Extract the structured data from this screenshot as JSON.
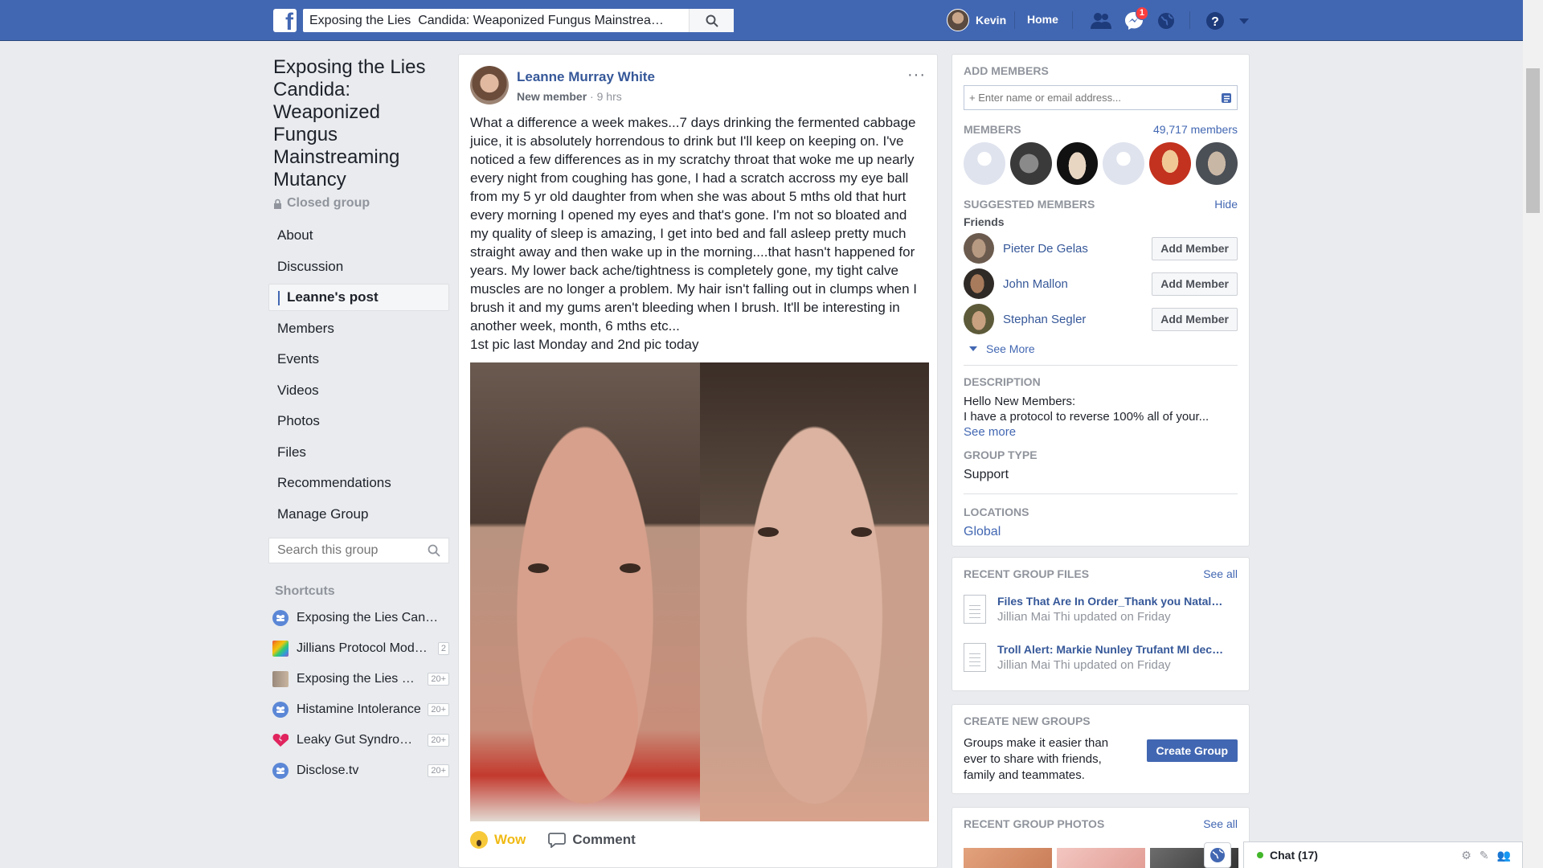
{
  "topbar": {
    "logo": "f",
    "search_value": "Exposing the Lies  Candida: Weaponized Fungus Mainstrea…",
    "user_name": "Kevin",
    "home_label": "Home",
    "messages_badge": "1"
  },
  "left": {
    "group_title": "Exposing the Lies Candida: Weaponized Fungus Mainstreaming Mutancy",
    "privacy": "Closed group",
    "nav": [
      "About",
      "Discussion",
      "Leanne's post",
      "Members",
      "Events",
      "Videos",
      "Photos",
      "Files",
      "Recommendations",
      "Manage Group"
    ],
    "search_placeholder": "Search this group",
    "shortcuts_title": "Shortcuts",
    "shortcuts": [
      {
        "label": "Exposing the Lies Cand…",
        "count": "",
        "icon": "group-icon"
      },
      {
        "label": "Jillians Protocol Mod…",
        "count": "2",
        "icon": "rainbow-icon"
      },
      {
        "label": "Exposing the Lies …",
        "count": "20+",
        "icon": "photo-icon"
      },
      {
        "label": "Histamine Intolerance",
        "count": "20+",
        "icon": "group-icon"
      },
      {
        "label": "Leaky Gut Syndro…",
        "count": "20+",
        "icon": "broken-heart-icon"
      },
      {
        "label": "Disclose.tv",
        "count": "20+",
        "icon": "group-icon"
      }
    ]
  },
  "post": {
    "author": "Leanne Murray White",
    "role": "New member",
    "time": "9 hrs",
    "text": "What a difference a week makes...7 days drinking the fermented cabbage juice, it is absolutely horrendous to drink but I'll keep on keeping on. I've noticed a few differences as in my scratchy throat that woke me up nearly every night from coughing has gone, I had a scratch accross my eye ball from my 5 yr old daughter from when she was about 5 mths old that hurt every morning I opened my eyes and that's gone. I'm not so bloated and my quality of sleep is amazing, I get into bed and fall asleep pretty much straight away and then wake up in the morning....that hasn't happened for years. My lower back ache/tightness is completely gone, my tight calve muscles are no longer a problem. My hair isn't falling out in clumps when I brush it and my gums aren't bleeding when I brush. It'll be interesting in another week, month, 6 mths etc...",
    "text2": "1st pic last Monday and 2nd pic today",
    "wow_label": "Wow",
    "comment_label": "Comment"
  },
  "right": {
    "add_members_title": "ADD MEMBERS",
    "add_placeholder": "+ Enter name or email address...",
    "members_title": "MEMBERS",
    "members_count": "49,717 members",
    "suggested_title": "SUGGESTED MEMBERS",
    "hide_label": "Hide",
    "friends_label": "Friends",
    "suggested": [
      {
        "name": "Pieter De Gelas",
        "button": "Add Member"
      },
      {
        "name": "John Mallon",
        "button": "Add Member"
      },
      {
        "name": "Stephan Segler",
        "button": "Add Member"
      }
    ],
    "see_more": "See More",
    "description_title": "DESCRIPTION",
    "description_line1": "Hello New Members:",
    "description_line2": "I have a protocol to reverse 100% all of your...",
    "description_see_more": "See more",
    "group_type_title": "GROUP TYPE",
    "group_type": "Support",
    "locations_title": "LOCATIONS",
    "location": "Global",
    "files_title": "RECENT GROUP FILES",
    "files_see_all": "See all",
    "files": [
      {
        "title": "Files That Are In Order_Thank you Natal…",
        "meta": "Jillian Mai Thi updated on Friday"
      },
      {
        "title": "Troll Alert: Markie Nunley Trufant MI dec…",
        "meta": "Jillian Mai Thi updated on Friday"
      }
    ],
    "create_title": "CREATE NEW GROUPS",
    "create_text": "Groups make it easier than ever to share with friends, family and teammates.",
    "create_button": "Create Group",
    "photos_title": "RECENT GROUP PHOTOS",
    "photos_see_all": "See all"
  },
  "chat": {
    "label": "Chat (17)"
  },
  "colors": {
    "brand": "#4267b2",
    "link": "#365899",
    "background": "#e9ebee"
  }
}
